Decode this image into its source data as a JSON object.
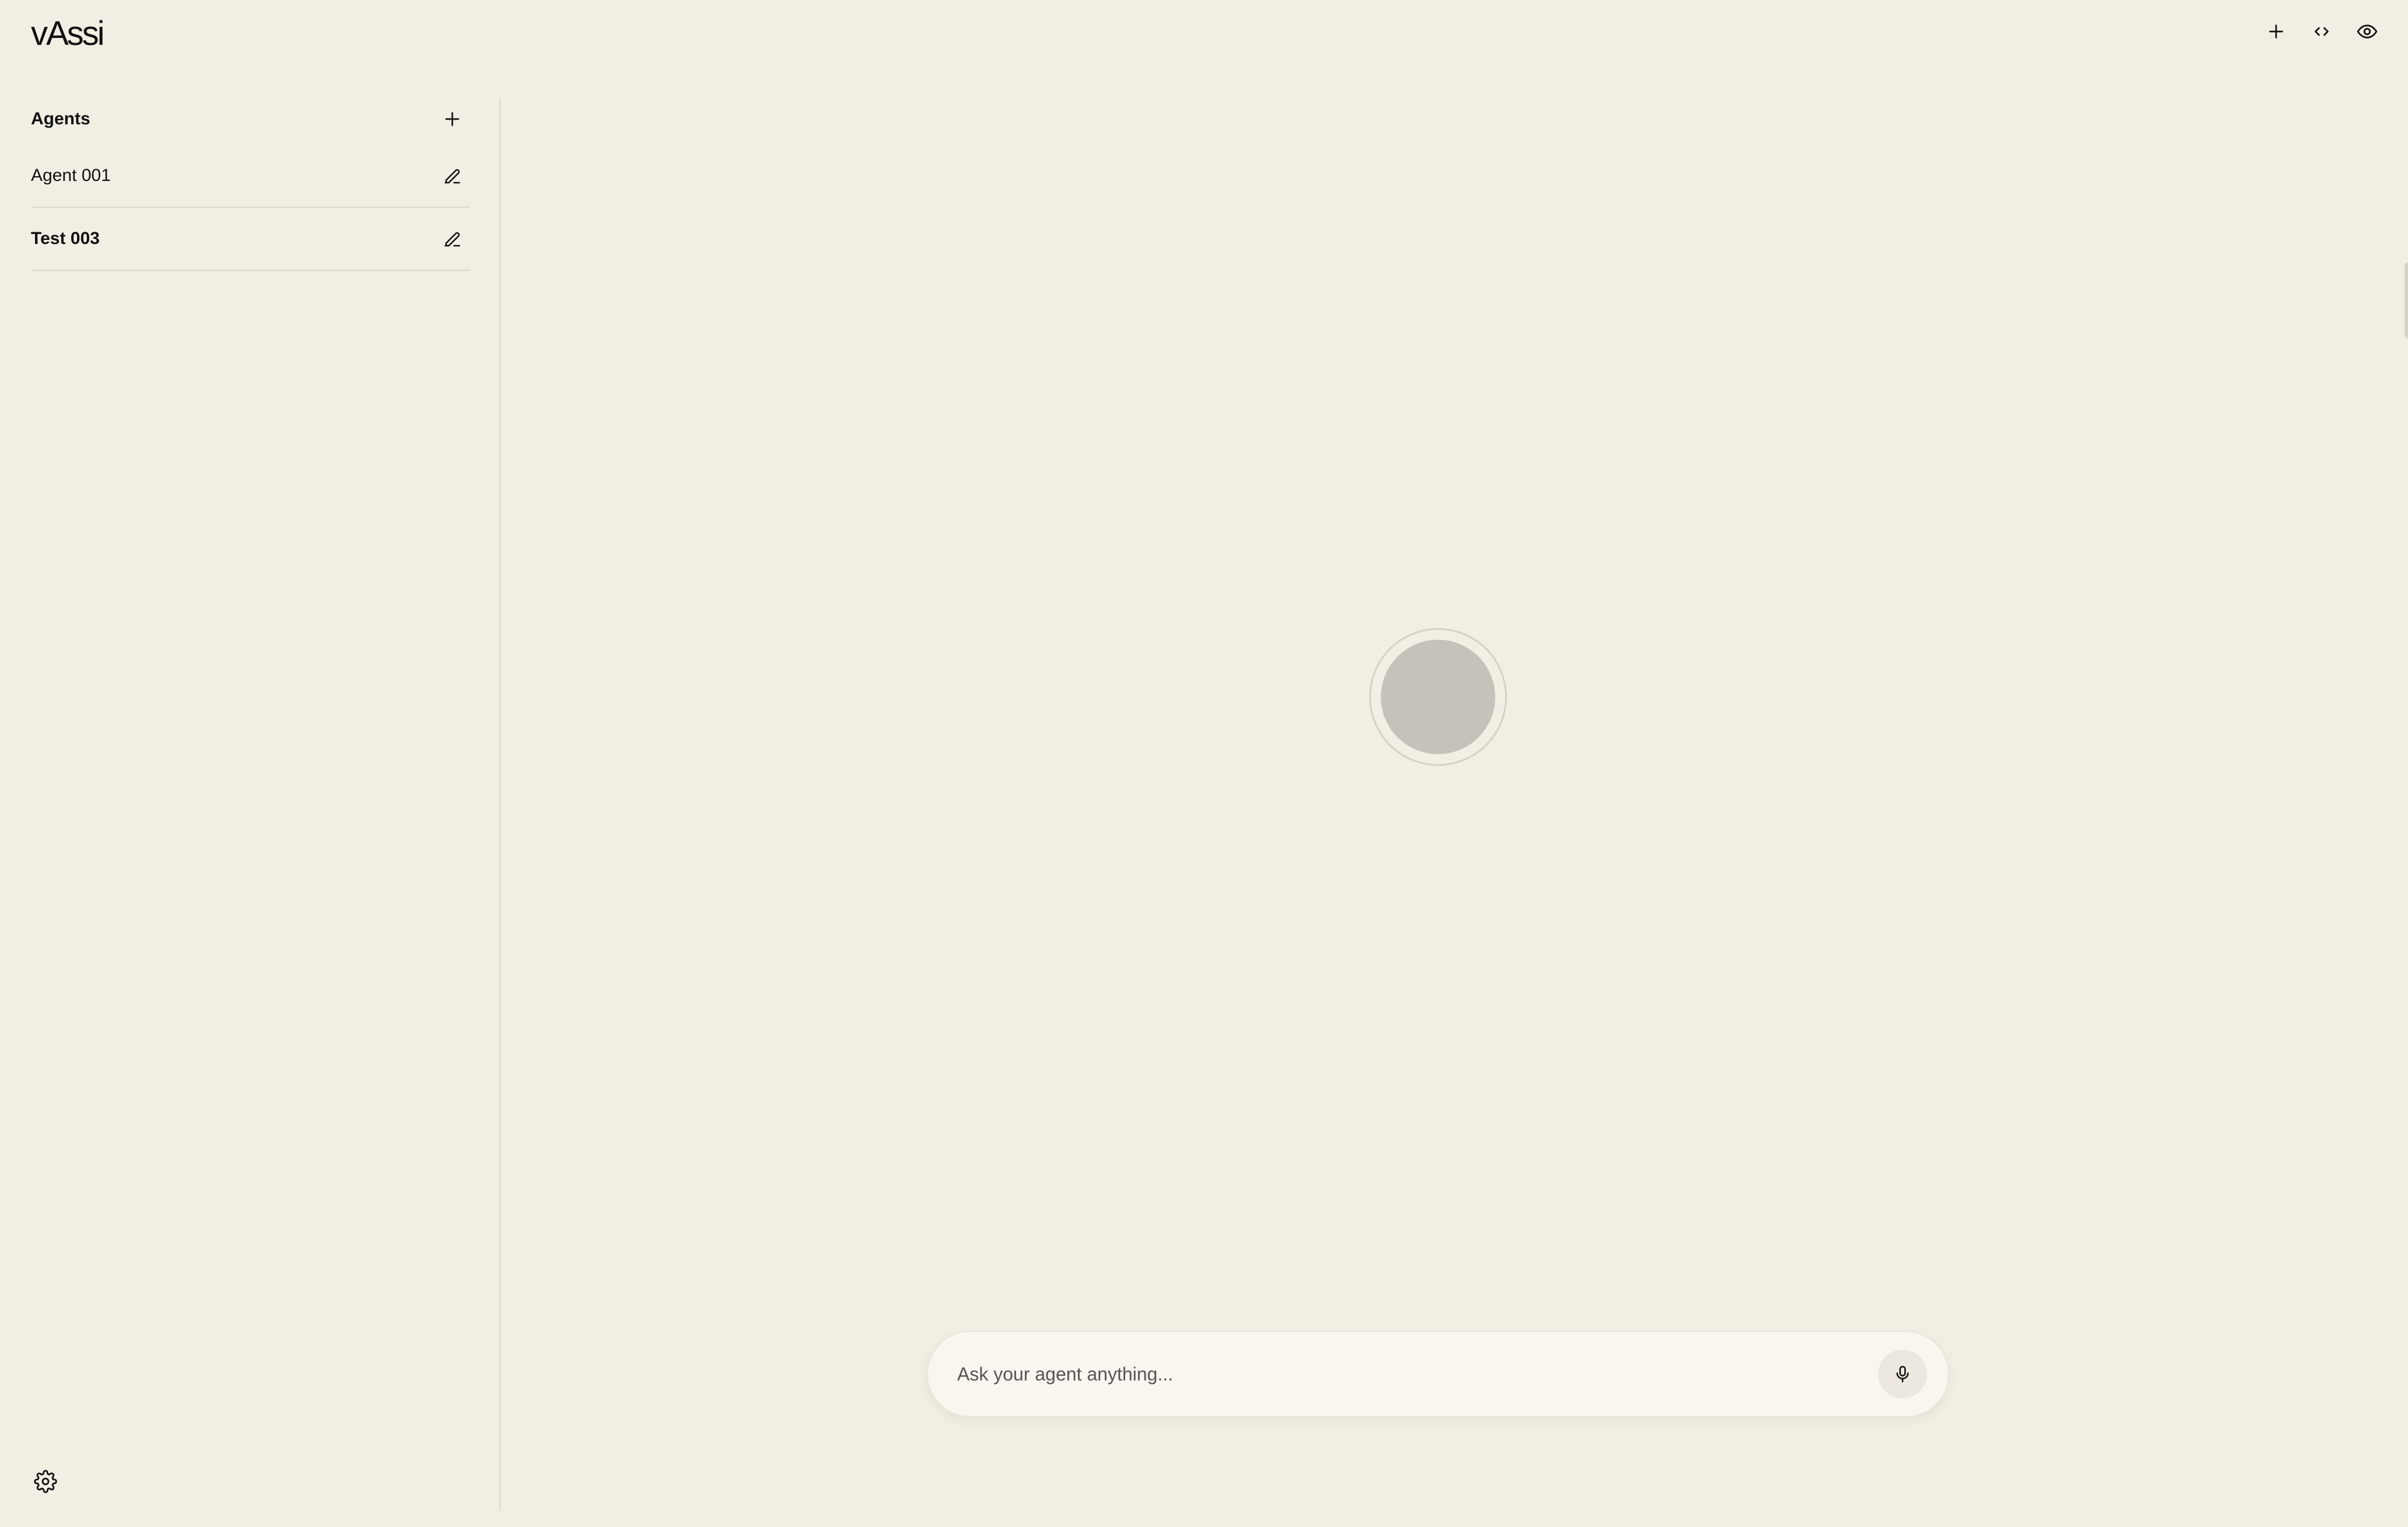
{
  "app": {
    "brand": "vAssi"
  },
  "topbar": {
    "actions": [
      {
        "icon": "plus-icon",
        "label": "New"
      },
      {
        "icon": "code-icon",
        "label": "Code"
      },
      {
        "icon": "eye-icon",
        "label": "Preview"
      }
    ]
  },
  "sidebar": {
    "title": "Agents",
    "add_icon": "plus-icon",
    "items": [
      {
        "label": "Agent 001",
        "active": false,
        "edit_icon": "pencil-icon"
      },
      {
        "label": "Test 003",
        "active": true,
        "edit_icon": "pencil-icon"
      }
    ],
    "settings_icon": "gear-icon"
  },
  "composer": {
    "placeholder": "Ask your agent anything...",
    "value": "",
    "mic_icon": "microphone-icon"
  },
  "colors": {
    "background": "#f2eee4",
    "orb": "#c6c2ba",
    "composer_bg": "#faf6ef",
    "divider": "#dcd7cb"
  }
}
